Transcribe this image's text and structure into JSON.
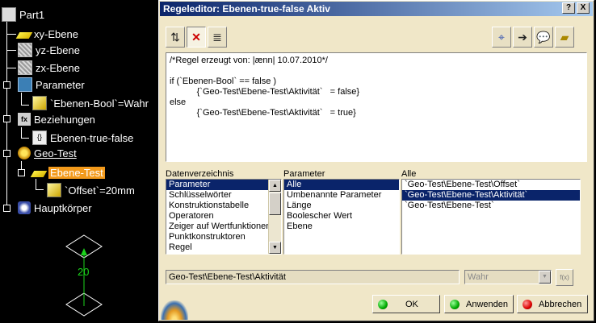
{
  "tree": {
    "items": [
      {
        "label": "Part1",
        "icon": "part-document-icon"
      },
      {
        "label": "xy-Ebene",
        "icon": "plane-icon"
      },
      {
        "label": "yz-Ebene",
        "icon": "plane-icon"
      },
      {
        "label": "zx-Ebene",
        "icon": "plane-icon"
      },
      {
        "label": "Parameter",
        "icon": "parameter-icon"
      },
      {
        "label": "`Ebenen-Bool`=Wahr",
        "icon": "boolean-parameter-icon"
      },
      {
        "label": "Beziehungen",
        "icon": "relations-icon"
      },
      {
        "label": "Ebenen-true-false",
        "icon": "rule-icon"
      },
      {
        "label": "Geo-Test",
        "icon": "geometrical-set-icon"
      },
      {
        "label": "Ebene-Test",
        "icon": "plane-icon"
      },
      {
        "label": "`Offset`=20mm",
        "icon": "length-parameter-icon"
      },
      {
        "label": "Hauptkörper",
        "icon": "part-body-icon"
      }
    ]
  },
  "viewport": {
    "dimension_label": "20",
    "dimension_color": "#1bd41b"
  },
  "dialog": {
    "title": "Regeleditor: Ebenen-true-false Aktiv",
    "title_help": "?",
    "title_close": "X",
    "editor_lines": [
      "/*Regel erzeugt von: |ænn| 10.07.2010*/",
      "",
      "if (`Ebenen-Bool` == false )",
      "           {`Geo-Test\\Ebene-Test\\Aktivität`   = false}",
      "else",
      "           {`Geo-Test\\Ebene-Test\\Aktivität`   = true}"
    ],
    "lists": {
      "dictionary": {
        "label": "Datenverzeichnis",
        "items": [
          "Parameter",
          "Schlüsselwörter",
          "Konstruktionstabelle",
          "Operatoren",
          "Zeiger auf Wertfunktionen",
          "Punktkonstruktoren",
          "Regel"
        ],
        "selected": 0
      },
      "parameter": {
        "label": "Parameter",
        "items": [
          "Alle",
          "Umbenannte Parameter",
          "Länge",
          "Boolescher Wert",
          "Ebene"
        ],
        "selected": 0
      },
      "all": {
        "label": "Alle",
        "items": [
          "`Geo-Test\\Ebene-Test\\Offset`",
          "`Geo-Test\\Ebene-Test\\Aktivität`",
          "`Geo-Test\\Ebene-Test`"
        ],
        "selected": 1
      }
    },
    "path_value": "Geo-Test\\Ebene-Test\\Aktivität",
    "value_combo": "Wahr",
    "buttons": {
      "ok": "OK",
      "apply": "Anwenden",
      "cancel": "Abbrechen"
    }
  }
}
